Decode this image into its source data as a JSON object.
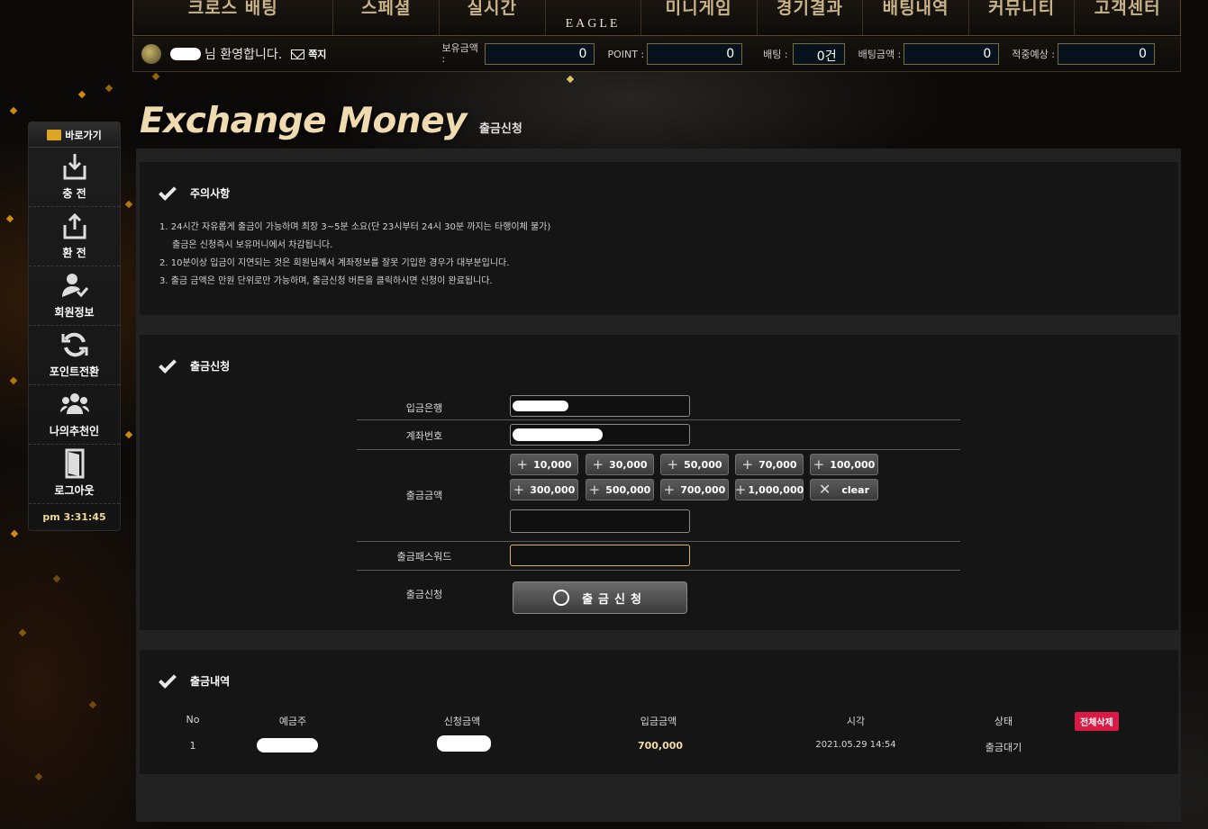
{
  "nav": {
    "items": [
      "크로스 배팅",
      "스페셜",
      "실시간",
      "미니게임",
      "경기결과",
      "배팅내역",
      "커뮤니티",
      "고객센터"
    ],
    "logo_text": "EAGLE"
  },
  "infobar": {
    "welcome_suffix": "님 환영합니다.",
    "message_label": "쪽지",
    "balance_label": "보유금액 :",
    "balance_value": "0",
    "point_label": "POINT :",
    "point_value": "0",
    "bet_label": "배팅 :",
    "bet_value": "0건",
    "bet_amount_label": "배팅금액 :",
    "bet_amount_value": "0",
    "expected_label": "적중예상 :",
    "expected_value": "0"
  },
  "title": {
    "main": "Exchange Money",
    "sub": "출금신청"
  },
  "sidebar": {
    "header": "바로가기",
    "items": [
      {
        "label": "충 전",
        "icon": "deposit-icon"
      },
      {
        "label": "환 전",
        "icon": "withdraw-icon"
      },
      {
        "label": "회원정보",
        "icon": "user-check-icon"
      },
      {
        "label": "포인트전환",
        "icon": "refresh-icon"
      },
      {
        "label": "나의추천인",
        "icon": "group-icon"
      },
      {
        "label": "로그아웃",
        "icon": "door-icon"
      }
    ],
    "clock": "pm 3:31:45"
  },
  "notice": {
    "title": "주의사항",
    "lines": [
      "1. 24시간 자유롭게 출금이 가능하며 최장 3~5분 소요(단 23시부터 24시 30분 까지는 타행이체 불가)",
      "    출금은 신청즉시 보유머니에서 차감됩니다.",
      "2. 10분이상 입금이 지연되는 것은 회원님께서 계좌정보를 잘못 기입한 경우가 대부분입니다.",
      "3. 출금 금액은 만원 단위로만 가능하며, 출금신청 버튼을 클릭하시면 신청이 완료됩니다."
    ]
  },
  "form": {
    "title": "출금신청",
    "bank_label": "입금은행",
    "account_label": "계좌번호",
    "amount_label": "출금금액",
    "password_label": "출금패스워드",
    "submit_label": "출금신청",
    "submit_button": "출금신청",
    "amount_buttons": [
      "10,000",
      "30,000",
      "50,000",
      "70,000",
      "100,000",
      "300,000",
      "500,000",
      "700,000",
      "1,000,000"
    ],
    "clear_label": "clear",
    "amount_value": "",
    "password_value": ""
  },
  "history": {
    "title": "출금내역",
    "columns": [
      "No",
      "예금주",
      "신청금액",
      "입금금액",
      "시각",
      "상태"
    ],
    "delete_all": "전체삭제",
    "rows": [
      {
        "no": "1",
        "deposit_amount": "700,000",
        "time": "2021.05.29 14:54",
        "status": "출금대기"
      }
    ]
  }
}
